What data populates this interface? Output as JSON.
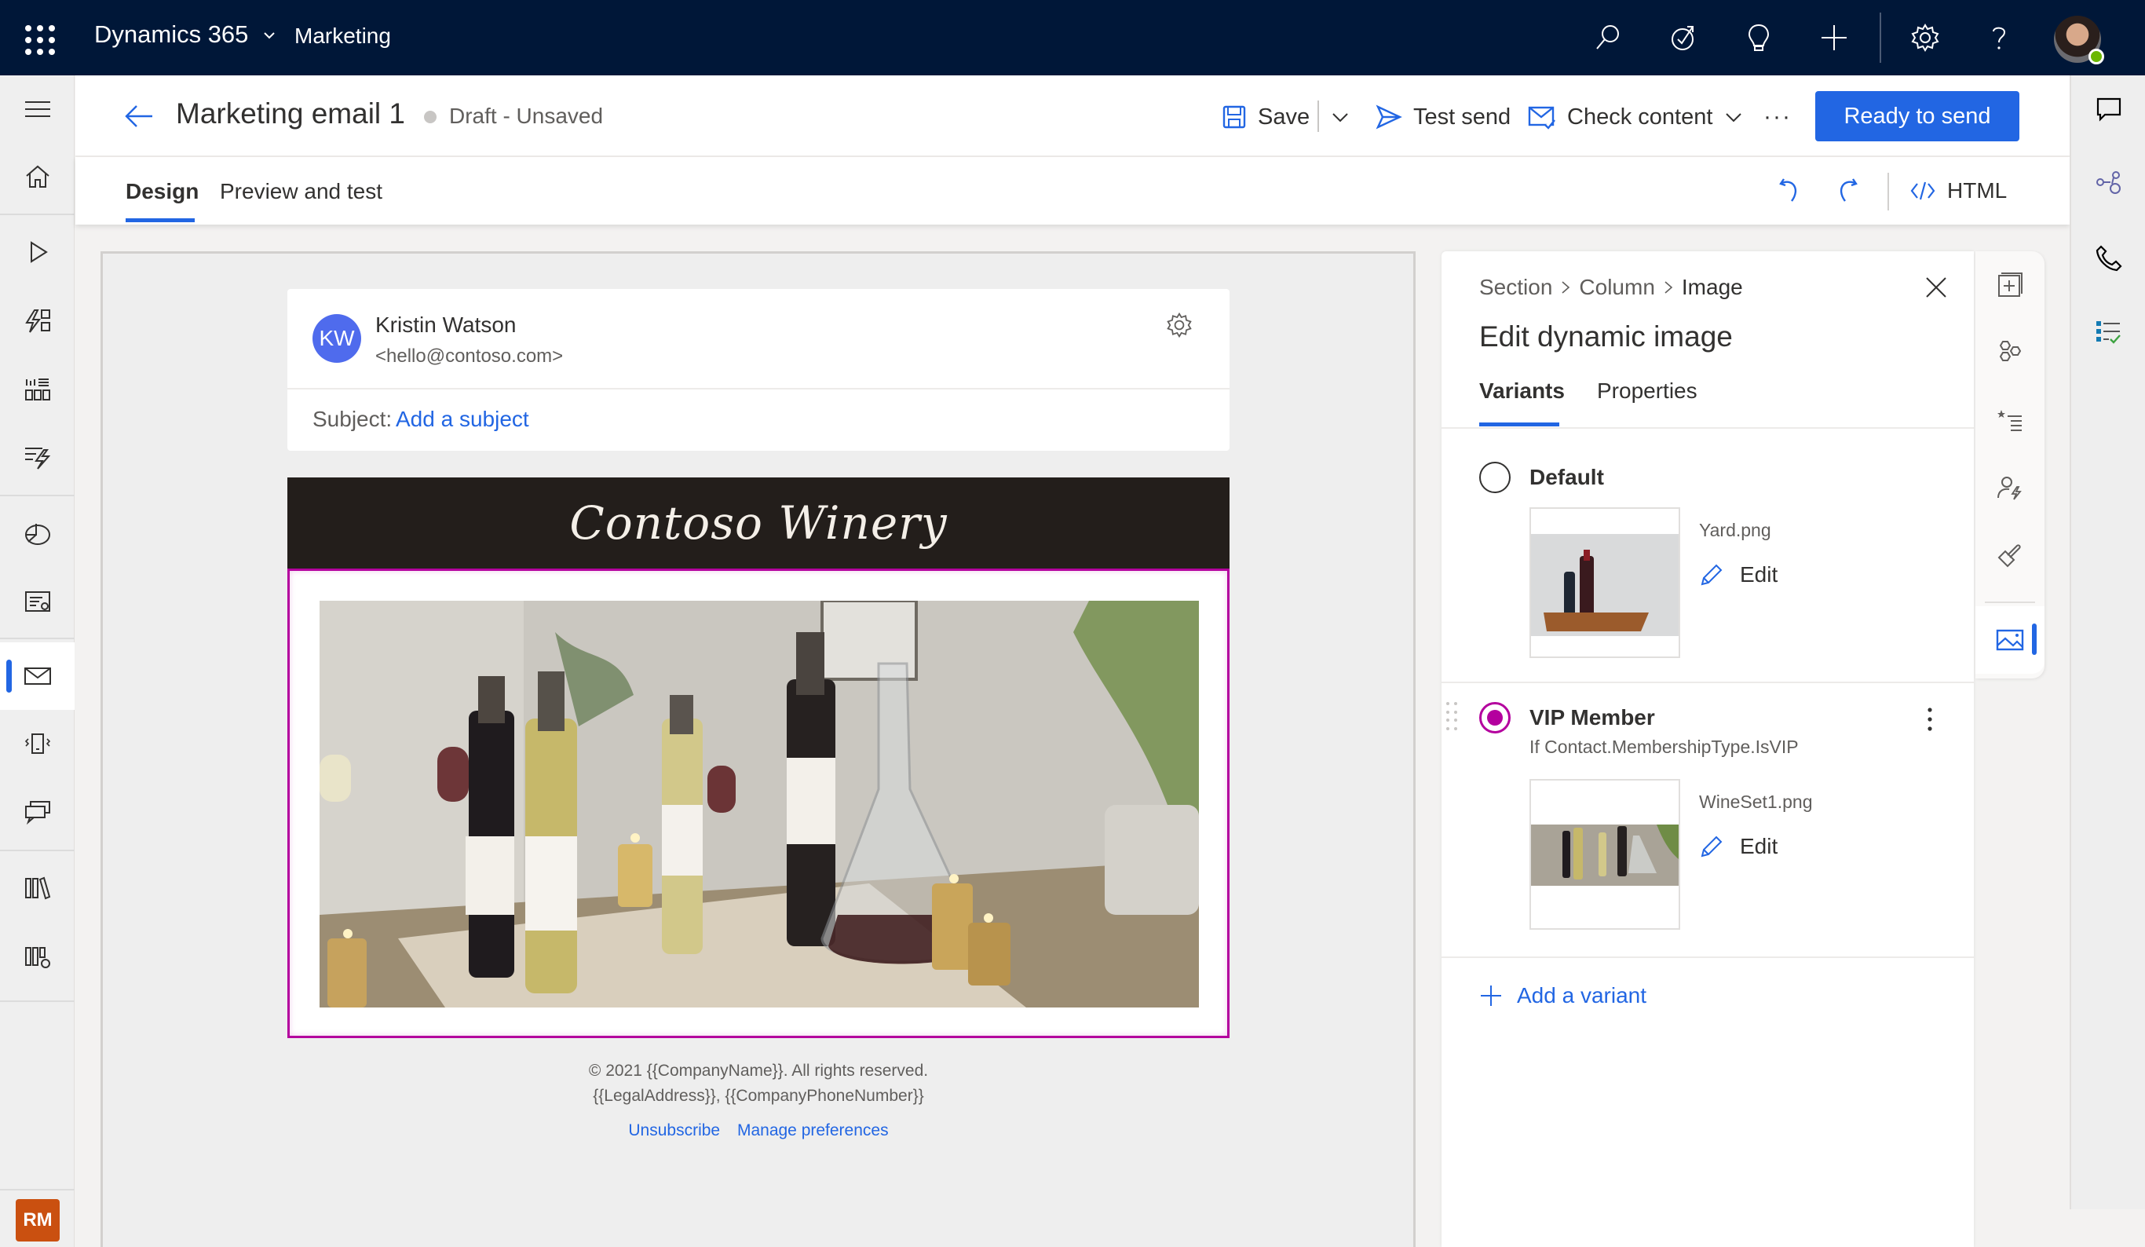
{
  "topbar": {
    "app_name": "Dynamics 365",
    "module": "Marketing",
    "icons": [
      "search-icon",
      "task-check-icon",
      "lightbulb-icon",
      "plus-icon",
      "settings-icon",
      "help-icon"
    ],
    "user_presence": "available"
  },
  "leftnav": {
    "items": [
      {
        "icon": "hamburger-icon"
      },
      {
        "icon": "home-icon"
      },
      {
        "icon": "play-icon"
      },
      {
        "icon": "journey-icon"
      },
      {
        "icon": "segments-icon"
      },
      {
        "icon": "triggers-icon"
      },
      {
        "icon": "analytics-icon"
      },
      {
        "icon": "forms-icon"
      },
      {
        "icon": "email-icon",
        "active": true
      },
      {
        "icon": "push-notification-icon"
      },
      {
        "icon": "text-message-icon"
      },
      {
        "icon": "library-icon"
      },
      {
        "icon": "asset-settings-icon"
      }
    ],
    "user_initials": "RM",
    "user_badge_color": "#ca5010"
  },
  "command_bar": {
    "title": "Marketing email 1",
    "status": "Draft - Unsaved",
    "save_label": "Save",
    "test_send_label": "Test send",
    "check_content_label": "Check content",
    "more_label": "···",
    "ready_label": "Ready to send"
  },
  "tabs": {
    "items": [
      {
        "label": "Design",
        "active": true
      },
      {
        "label": "Preview and test",
        "active": false
      }
    ],
    "html_label": "HTML"
  },
  "email": {
    "sender_initials": "KW",
    "sender_name": "Kristin Watson",
    "sender_email": "<hello@contoso.com>",
    "subject_label": "Subject:",
    "subject_placeholder": "Add a subject",
    "banner_text": "Contoso Winery",
    "hero_alt": "Wine bottles and decanter on a dinner table",
    "footer_line1": "© 2021 {{CompanyName}}. All rights reserved.",
    "footer_line2": "{{LegalAddress}}, {{CompanyPhoneNumber}}",
    "unsubscribe": "Unsubscribe",
    "manage_preferences": "Manage preferences"
  },
  "panel": {
    "breadcrumb": [
      "Section",
      "Column",
      "Image"
    ],
    "title": "Edit dynamic image",
    "tabs": [
      {
        "label": "Variants",
        "active": true
      },
      {
        "label": "Properties",
        "active": false
      }
    ],
    "variants": [
      {
        "name": "Default",
        "condition": "",
        "file": "Yard.png",
        "edit_label": "Edit",
        "selected": false
      },
      {
        "name": "VIP Member",
        "condition": "If Contact.MembershipType.IsVIP",
        "file": "WineSet1.png",
        "edit_label": "Edit",
        "selected": true
      }
    ],
    "add_variant_label": "Add a variant"
  },
  "panel_rail": {
    "items": [
      "add-section-icon",
      "elements-icon",
      "personalization-icon",
      "dynamic-content-icon",
      "styles-icon",
      "image-icon"
    ],
    "active": "image-icon"
  },
  "far_rail": {
    "items": [
      "chat-icon",
      "connections-icon",
      "phone-icon",
      "tasks-icon"
    ]
  },
  "colors": {
    "brand": "#2266e3",
    "topbar": "#001738",
    "selection": "#b4009e"
  }
}
